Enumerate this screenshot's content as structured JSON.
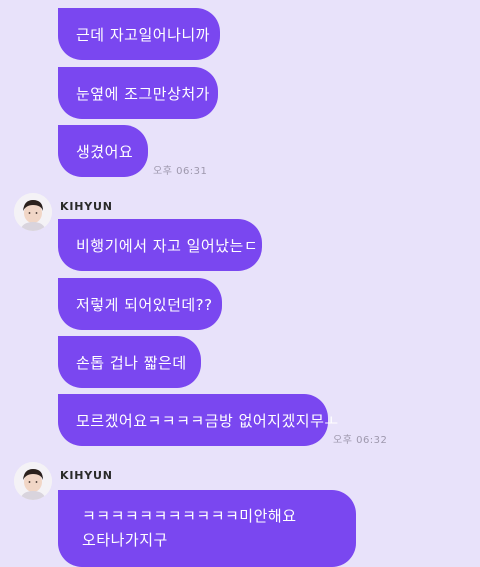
{
  "messages_top": [
    {
      "text": "근데 자고일어나니까"
    },
    {
      "text": "눈옆에 조그만상처가"
    },
    {
      "text": "생겼어요"
    }
  ],
  "timestamp_1": "오후 06:31",
  "group_1": {
    "sender": "KIHYUN",
    "messages": [
      {
        "text": "비행기에서 자고 일어났는ㄷ"
      },
      {
        "text": "저렇게 되어있던데??"
      },
      {
        "text": "손톱 겁나 짧은데"
      },
      {
        "text": "모르겠어요ㅋㅋㅋㅋ금방 없어지겠지무ㅗ"
      }
    ],
    "timestamp": "오후 06:32"
  },
  "group_2": {
    "sender": "KIHYUN",
    "message_lines": [
      "ㅋㅋㅋㅋㅋㅋㅋㅋㅋㅋㅋ미안해요",
      "오타나가지구"
    ]
  },
  "colors": {
    "background": "#e8e2fa",
    "bubble": "#7a47f0",
    "bubble_text": "#ffffff",
    "timestamp": "#9e98ad"
  }
}
